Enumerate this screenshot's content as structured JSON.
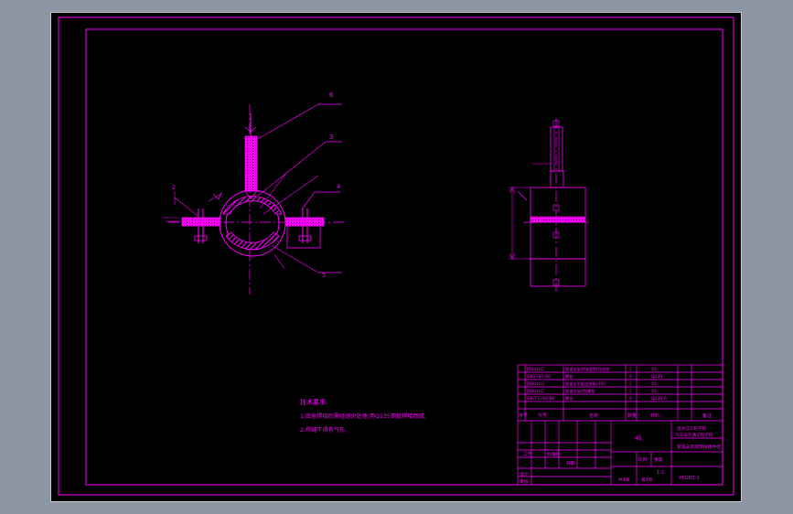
{
  "colors": {
    "workspace": "#8d96a4",
    "canvas": "#000000",
    "line": "#ff00ff",
    "hatch": "#ff00ff",
    "frame_border": "#c8c8d0"
  },
  "balloons": {
    "b1": "6",
    "b2": "3",
    "b3": "4",
    "b4": "5",
    "b5": "2"
  },
  "notes": {
    "title": "技术要求:",
    "line1": "1.底座焊接后需经退火处理,用Q235钢板焊接而成.",
    "line2": "2.焊缝不得有气孔."
  },
  "bom": {
    "rows": [
      {
        "code": "JT04102",
        "name": "管道支架焊接组件T型底座",
        "qty": "1",
        "material": "45"
      },
      {
        "code": "GB5781-86",
        "name": "螺栓",
        "qty": "4",
        "material": "Q235"
      },
      {
        "code": "JT06103",
        "name": "管道支吊架连接板L100",
        "qty": "1",
        "material": "45"
      },
      {
        "code": "JT06102",
        "name": "管道吊架U型螺栓",
        "qty": "1",
        "material": "45"
      },
      {
        "code": "GB/T5780-86",
        "name": "螺母",
        "qty": "4",
        "material": "Q235-A"
      }
    ],
    "header": {
      "seq": "序号",
      "code": "代号",
      "name": "名称",
      "qty": "数量",
      "material": "材料",
      "note": "备注"
    },
    "part_material": "45",
    "school": "黑龙江工程学院",
    "dept": "汽车与交通工程学院",
    "drawing_name": "管道支吊架焊接组件图",
    "drawing_no": "XKGDZ-1",
    "design": "设计",
    "review": "审核",
    "scale_label": "比例",
    "weight_label": "重量",
    "count_label": "共1张",
    "sheet_label": "第1张",
    "scale_value": "1:1",
    "std_label": "标准化",
    "process_label": "工艺",
    "date_label": "日期"
  }
}
